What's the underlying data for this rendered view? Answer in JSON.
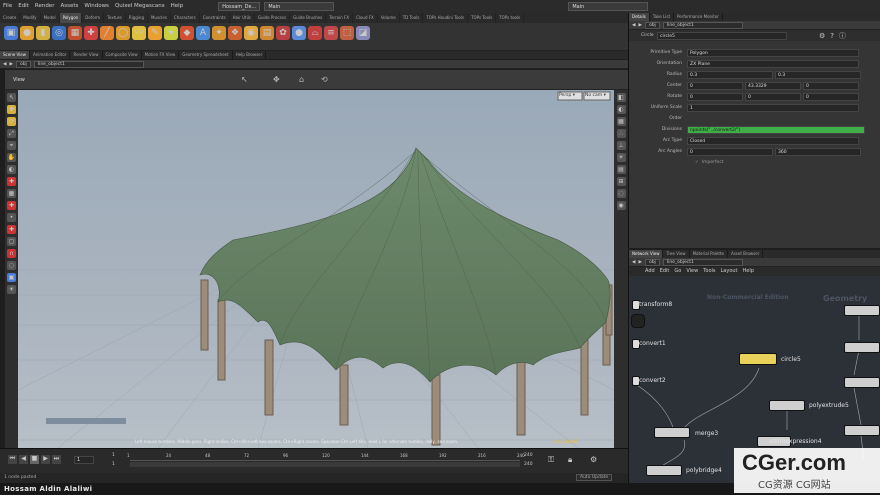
{
  "menubar": {
    "items": [
      "File",
      "Edit",
      "Render",
      "Assets",
      "Windows",
      "Quixel Megascans",
      "Help"
    ],
    "scene_title": "Hossam_De...",
    "desktop": "Main",
    "search": "Main"
  },
  "shelf": {
    "tabs": [
      "Create",
      "Modify",
      "Model",
      "Polygon",
      "Deform",
      "Texture",
      "Rigging",
      "Muscles",
      "Characters",
      "Constraints",
      "Hair Utils",
      "Guide Process",
      "Guide Brushes",
      "Terrain FX",
      "Cloud FX",
      "Volume",
      "TD Tools",
      "TOPs Houdini Tools",
      "TOPs Tools",
      "TOPs tools"
    ],
    "active_tab": "Polygon"
  },
  "viewer": {
    "pane_tabs": [
      "Scene View",
      "Animation Editor",
      "Render View",
      "Composite View",
      "Motion FX View",
      "Geometry Spreadsheet",
      "Help Browser"
    ],
    "path_root": "obj",
    "path_node": "line_object1",
    "view_label": "View",
    "persp_label": "Persp ▾",
    "cam_label": "No cam ▾",
    "hint": "Left mouse tumbles. Middle pans. Right dollies. Ctrl+Alt+Left box-zooms. Ctrl+Right zooms. Spacebar-Ctrl-Left tilts. Hold L for alternate tumble, dolly, and zoom.",
    "node_badge": "line_object1"
  },
  "timeline": {
    "frame": "1",
    "start": "1",
    "end": "1",
    "range_end": "240",
    "range_end2": "240",
    "ticks": [
      "1",
      "24",
      "48",
      "72",
      "96",
      "120",
      "144",
      "168",
      "192",
      "216",
      "240"
    ]
  },
  "status": {
    "text": "1 node pasted",
    "auto_update": "Auto Update"
  },
  "caption": "Hossam Aldin Alaliwi",
  "params": {
    "tabs": [
      "Details",
      "Take List",
      "Performance Monitor"
    ],
    "path_root": "obj",
    "path_node": "line_object1",
    "node_type": "Circle",
    "node_name": "circle5",
    "rows": [
      {
        "label": "Primitive Type",
        "values": [
          "Polygon"
        ]
      },
      {
        "label": "Orientation",
        "values": [
          "ZX Plane"
        ]
      },
      {
        "label": "Radius",
        "values": [
          "0.3",
          "0.3"
        ]
      },
      {
        "label": "Center",
        "values": [
          "0",
          "43.3329",
          "0"
        ]
      },
      {
        "label": "Rotate",
        "values": [
          "0",
          "0",
          "0"
        ]
      },
      {
        "label": "Uniform Scale",
        "values": [
          "1"
        ]
      },
      {
        "label": "Order",
        "values": [
          ""
        ]
      },
      {
        "label": "Divisions",
        "values": [
          "npoints(\"../convert2/\")"
        ]
      },
      {
        "label": "Arc Type",
        "values": [
          "Closed"
        ]
      },
      {
        "label": "Arc Angles",
        "values": [
          "0",
          "360"
        ]
      }
    ],
    "imperfect": "Imperfect"
  },
  "network": {
    "tabs": [
      "Network View",
      "Tree View",
      "Material Palette",
      "Asset Browser"
    ],
    "path_root": "obj",
    "path_node": "line_object1",
    "menu": [
      "Add",
      "Edit",
      "Go",
      "View",
      "Tools",
      "Layout",
      "Help"
    ],
    "watermark": "Non-Commercial Edition",
    "geometry": "Geometry",
    "nodes": [
      "transform8",
      "convert1",
      "convert2",
      "circle5",
      "polyextrude5",
      "merge3",
      "attribexpression4",
      "polybridge4"
    ]
  },
  "overlay": {
    "big": "CGer.com",
    "small": "CG资源 CG网站"
  },
  "colors": {
    "accent": "#f0c040",
    "selected_node": "#e8d25a",
    "param_green": "#3fae49",
    "shelf_bg": "#333333"
  }
}
